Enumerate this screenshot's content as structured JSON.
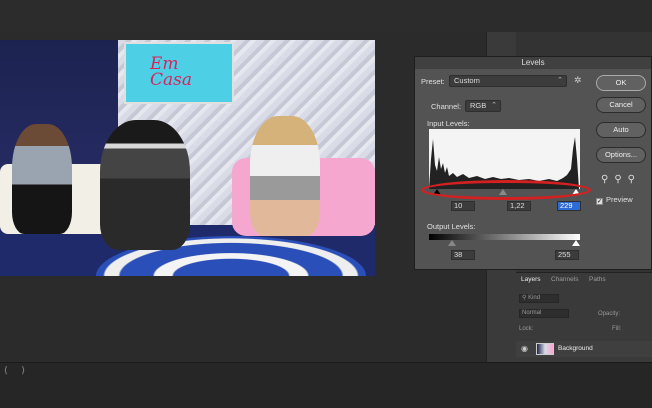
{
  "levels_dialog": {
    "title": "Levels",
    "preset_label": "Preset:",
    "preset_value": "Custom",
    "channel_label": "Channel:",
    "channel_value": "RGB",
    "input_levels_label": "Input Levels:",
    "input_black": "10",
    "input_gamma": "1,22",
    "input_white": "229",
    "output_levels_label": "Output Levels:",
    "output_black": "38",
    "output_white": "255",
    "buttons": {
      "ok": "OK",
      "cancel": "Cancel",
      "auto": "Auto",
      "options": "Options..."
    },
    "preview_label": "Preview",
    "preview_checked": true
  },
  "photo": {
    "screen_text_line1": "Em",
    "screen_text_line2": "Casa"
  },
  "layers_panel": {
    "tabs": [
      "Layers",
      "Channels",
      "Paths"
    ],
    "active_tab": "Layers",
    "kind_placeholder": "Kind",
    "blend_mode": "Normal",
    "opacity_label": "Opacity:",
    "lock_label": "Lock:",
    "fill_label": "Fill:",
    "layer_name": "Background"
  },
  "colors": {
    "accent": "#2f6bd4",
    "highlight": "#d42020"
  }
}
